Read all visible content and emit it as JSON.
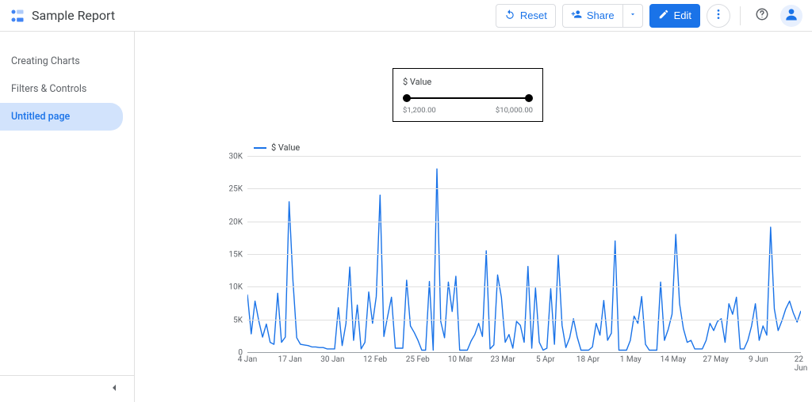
{
  "header": {
    "title": "Sample Report",
    "reset_label": "Reset",
    "share_label": "Share",
    "edit_label": "Edit"
  },
  "sidebar": {
    "items": [
      {
        "label": "Creating Charts",
        "active": false
      },
      {
        "label": "Filters & Controls",
        "active": false
      },
      {
        "label": "Untitled page",
        "active": true
      }
    ]
  },
  "slider": {
    "title": "$ Value",
    "min_label": "$1,200.00",
    "max_label": "$10,000.00"
  },
  "legend": {
    "series_label": "$ Value"
  },
  "chart_data": {
    "type": "line",
    "title": "",
    "ylabel": "",
    "xlabel": "",
    "ylim": [
      0,
      30000
    ],
    "y_ticks": [
      "0",
      "5K",
      "10K",
      "15K",
      "20K",
      "25K",
      "30K"
    ],
    "x_ticks": [
      "4 Jan",
      "17 Jan",
      "30 Jan",
      "12 Feb",
      "25 Feb",
      "10 Mar",
      "23 Mar",
      "5 Apr",
      "18 Apr",
      "1 May",
      "14 May",
      "27 May",
      "9 Jun",
      "22 Jun"
    ],
    "series": [
      {
        "name": "$ Value",
        "color": "#1a73e8",
        "values": [
          8800,
          2800,
          7800,
          4800,
          2300,
          4300,
          1500,
          1200,
          9000,
          1500,
          2300,
          23000,
          11000,
          2200,
          1200,
          1100,
          1000,
          800,
          800,
          700,
          700,
          500,
          500,
          500,
          6800,
          1000,
          4400,
          13000,
          1800,
          7200,
          500,
          1500,
          9200,
          4400,
          8500,
          24000,
          2400,
          5500,
          8400,
          600,
          600,
          600,
          11000,
          4000,
          3000,
          1800,
          300,
          300,
          10800,
          300,
          28000,
          4700,
          2200,
          10700,
          6200,
          11600,
          300,
          300,
          300,
          1700,
          2700,
          4400,
          2400,
          15500,
          500,
          1100,
          11800,
          8400,
          1500,
          2700,
          600,
          4700,
          4100,
          1500,
          13100,
          600,
          9800,
          1500,
          300,
          600,
          9700,
          1200,
          14800,
          4100,
          700,
          2200,
          5100,
          2300,
          300,
          300,
          300,
          800,
          4400,
          2600,
          7900,
          1800,
          2900,
          17000,
          300,
          300,
          300,
          1800,
          5500,
          4400,
          8500,
          1200,
          300,
          300,
          300,
          10700,
          1800,
          3500,
          5800,
          18000,
          7400,
          3600,
          1500,
          1800,
          500,
          500,
          500,
          1800,
          4400,
          3300,
          4700,
          5100,
          1500,
          7400,
          5800,
          8400,
          500,
          500,
          1800,
          4000,
          7400,
          1800,
          4000,
          2600,
          19100,
          6600,
          3300,
          4800,
          6600,
          7800,
          6000,
          4600,
          6300
        ]
      }
    ]
  }
}
